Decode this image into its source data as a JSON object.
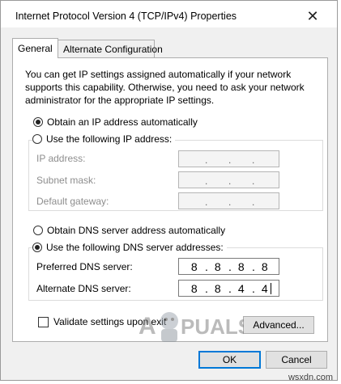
{
  "window": {
    "title": "Internet Protocol Version 4 (TCP/IPv4) Properties",
    "close_glyph": "✕"
  },
  "tabs": [
    {
      "label": "General",
      "active": true
    },
    {
      "label": "Alternate Configuration",
      "active": false
    }
  ],
  "intro_text": "You can get IP settings assigned automatically if your network supports this capability. Otherwise, you need to ask your network administrator for the appropriate IP settings.",
  "ip_mode": {
    "auto_label": "Obtain an IP address automatically",
    "auto_selected": true,
    "manual_label": "Use the following IP address:",
    "manual_selected": false,
    "fields": [
      {
        "label": "IP address:",
        "value": [
          "",
          "",
          "",
          ""
        ]
      },
      {
        "label": "Subnet mask:",
        "value": [
          "",
          "",
          "",
          ""
        ]
      },
      {
        "label": "Default gateway:",
        "value": [
          "",
          "",
          "",
          ""
        ]
      }
    ]
  },
  "dns_mode": {
    "auto_label": "Obtain DNS server address automatically",
    "auto_selected": false,
    "manual_label": "Use the following DNS server addresses:",
    "manual_selected": true,
    "preferred": {
      "label": "Preferred DNS server:",
      "octets": [
        "8",
        "8",
        "8",
        "8"
      ]
    },
    "alternate": {
      "label": "Alternate DNS server:",
      "octets": [
        "8",
        "8",
        "4",
        "4"
      ]
    }
  },
  "validate": {
    "label": "Validate settings upon exit",
    "checked": false
  },
  "buttons": {
    "advanced": "Advanced...",
    "ok": "OK",
    "cancel": "Cancel"
  },
  "watermark": {
    "brand": "A PUALS",
    "site": "wsxdn.com"
  },
  "colors": {
    "accent": "#0078d7",
    "dialog_bg": "#f0f0f0"
  }
}
